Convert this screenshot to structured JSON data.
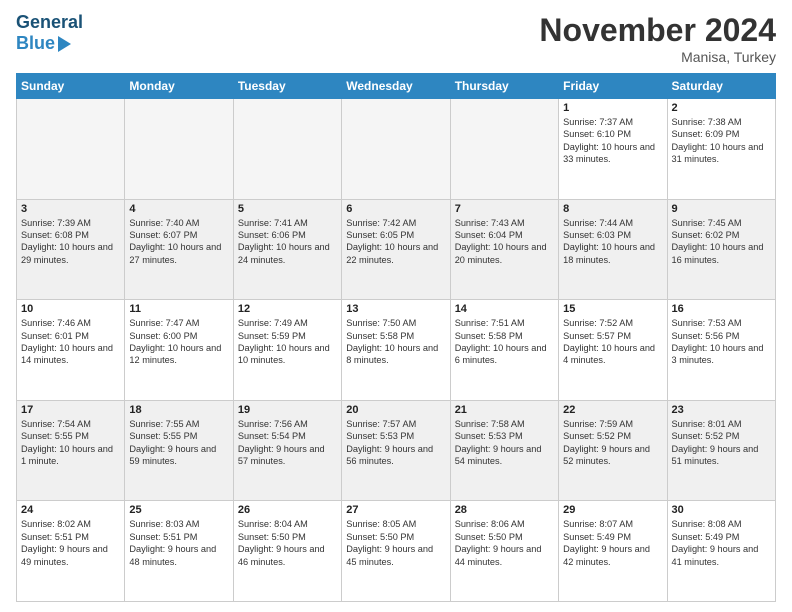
{
  "header": {
    "logo_line1": "General",
    "logo_line2": "Blue",
    "month_title": "November 2024",
    "location": "Manisa, Turkey"
  },
  "days_of_week": [
    "Sunday",
    "Monday",
    "Tuesday",
    "Wednesday",
    "Thursday",
    "Friday",
    "Saturday"
  ],
  "weeks": [
    [
      {
        "day": "",
        "info": ""
      },
      {
        "day": "",
        "info": ""
      },
      {
        "day": "",
        "info": ""
      },
      {
        "day": "",
        "info": ""
      },
      {
        "day": "",
        "info": ""
      },
      {
        "day": "1",
        "info": "Sunrise: 7:37 AM\nSunset: 6:10 PM\nDaylight: 10 hours and 33 minutes."
      },
      {
        "day": "2",
        "info": "Sunrise: 7:38 AM\nSunset: 6:09 PM\nDaylight: 10 hours and 31 minutes."
      }
    ],
    [
      {
        "day": "3",
        "info": "Sunrise: 7:39 AM\nSunset: 6:08 PM\nDaylight: 10 hours and 29 minutes."
      },
      {
        "day": "4",
        "info": "Sunrise: 7:40 AM\nSunset: 6:07 PM\nDaylight: 10 hours and 27 minutes."
      },
      {
        "day": "5",
        "info": "Sunrise: 7:41 AM\nSunset: 6:06 PM\nDaylight: 10 hours and 24 minutes."
      },
      {
        "day": "6",
        "info": "Sunrise: 7:42 AM\nSunset: 6:05 PM\nDaylight: 10 hours and 22 minutes."
      },
      {
        "day": "7",
        "info": "Sunrise: 7:43 AM\nSunset: 6:04 PM\nDaylight: 10 hours and 20 minutes."
      },
      {
        "day": "8",
        "info": "Sunrise: 7:44 AM\nSunset: 6:03 PM\nDaylight: 10 hours and 18 minutes."
      },
      {
        "day": "9",
        "info": "Sunrise: 7:45 AM\nSunset: 6:02 PM\nDaylight: 10 hours and 16 minutes."
      }
    ],
    [
      {
        "day": "10",
        "info": "Sunrise: 7:46 AM\nSunset: 6:01 PM\nDaylight: 10 hours and 14 minutes."
      },
      {
        "day": "11",
        "info": "Sunrise: 7:47 AM\nSunset: 6:00 PM\nDaylight: 10 hours and 12 minutes."
      },
      {
        "day": "12",
        "info": "Sunrise: 7:49 AM\nSunset: 5:59 PM\nDaylight: 10 hours and 10 minutes."
      },
      {
        "day": "13",
        "info": "Sunrise: 7:50 AM\nSunset: 5:58 PM\nDaylight: 10 hours and 8 minutes."
      },
      {
        "day": "14",
        "info": "Sunrise: 7:51 AM\nSunset: 5:58 PM\nDaylight: 10 hours and 6 minutes."
      },
      {
        "day": "15",
        "info": "Sunrise: 7:52 AM\nSunset: 5:57 PM\nDaylight: 10 hours and 4 minutes."
      },
      {
        "day": "16",
        "info": "Sunrise: 7:53 AM\nSunset: 5:56 PM\nDaylight: 10 hours and 3 minutes."
      }
    ],
    [
      {
        "day": "17",
        "info": "Sunrise: 7:54 AM\nSunset: 5:55 PM\nDaylight: 10 hours and 1 minute."
      },
      {
        "day": "18",
        "info": "Sunrise: 7:55 AM\nSunset: 5:55 PM\nDaylight: 9 hours and 59 minutes."
      },
      {
        "day": "19",
        "info": "Sunrise: 7:56 AM\nSunset: 5:54 PM\nDaylight: 9 hours and 57 minutes."
      },
      {
        "day": "20",
        "info": "Sunrise: 7:57 AM\nSunset: 5:53 PM\nDaylight: 9 hours and 56 minutes."
      },
      {
        "day": "21",
        "info": "Sunrise: 7:58 AM\nSunset: 5:53 PM\nDaylight: 9 hours and 54 minutes."
      },
      {
        "day": "22",
        "info": "Sunrise: 7:59 AM\nSunset: 5:52 PM\nDaylight: 9 hours and 52 minutes."
      },
      {
        "day": "23",
        "info": "Sunrise: 8:01 AM\nSunset: 5:52 PM\nDaylight: 9 hours and 51 minutes."
      }
    ],
    [
      {
        "day": "24",
        "info": "Sunrise: 8:02 AM\nSunset: 5:51 PM\nDaylight: 9 hours and 49 minutes."
      },
      {
        "day": "25",
        "info": "Sunrise: 8:03 AM\nSunset: 5:51 PM\nDaylight: 9 hours and 48 minutes."
      },
      {
        "day": "26",
        "info": "Sunrise: 8:04 AM\nSunset: 5:50 PM\nDaylight: 9 hours and 46 minutes."
      },
      {
        "day": "27",
        "info": "Sunrise: 8:05 AM\nSunset: 5:50 PM\nDaylight: 9 hours and 45 minutes."
      },
      {
        "day": "28",
        "info": "Sunrise: 8:06 AM\nSunset: 5:50 PM\nDaylight: 9 hours and 44 minutes."
      },
      {
        "day": "29",
        "info": "Sunrise: 8:07 AM\nSunset: 5:49 PM\nDaylight: 9 hours and 42 minutes."
      },
      {
        "day": "30",
        "info": "Sunrise: 8:08 AM\nSunset: 5:49 PM\nDaylight: 9 hours and 41 minutes."
      }
    ]
  ]
}
